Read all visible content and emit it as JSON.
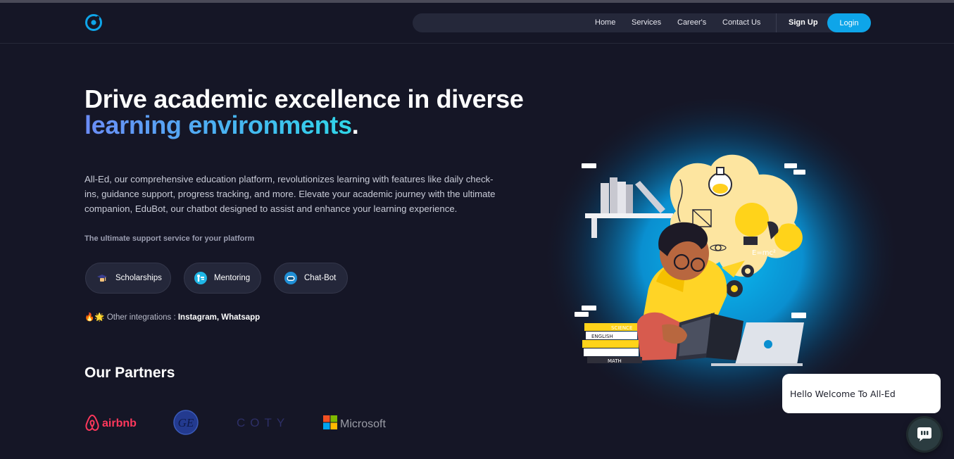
{
  "nav": {
    "links": [
      "Home",
      "Services",
      "Career's",
      "Contact Us"
    ],
    "signup": "Sign Up",
    "login": "Login"
  },
  "hero": {
    "line1": "Drive academic excellence in diverse",
    "line2_highlight": "learning environments",
    "line2_suffix": ".",
    "description": "All-Ed, our comprehensive education platform, revolutionizes learning with features like daily check-ins, guidance support, progress tracking, and more. Elevate your academic journey with the ultimate companion, EduBot, our chatbot designed to assist and enhance your learning experience.",
    "subtitle": "The ultimate support service for your platform"
  },
  "features": [
    {
      "label": "Scholarships",
      "icon": "scholarship-icon"
    },
    {
      "label": "Mentoring",
      "icon": "mentoring-icon"
    },
    {
      "label": "Chat-Bot",
      "icon": "chatbot-icon"
    }
  ],
  "integrations": {
    "emoji": "🔥🌟",
    "prefix": "Other integrations :",
    "names": "Instagram, Whatsapp"
  },
  "partners": {
    "title": "Our Partners",
    "logos": [
      "airbnb",
      "GE",
      "COTY",
      "Microsoft"
    ]
  },
  "illustration": {
    "book_labels": [
      "SCIENCE",
      "ENGLISH",
      "MATH"
    ],
    "formula": "E=mc²"
  },
  "chat": {
    "welcome": "Hello Welcome To All-Ed"
  },
  "colors": {
    "background": "#151626",
    "accent": "#0ea5e9",
    "gradient_start": "#6b8cf7",
    "gradient_end": "#2fd6e8"
  }
}
